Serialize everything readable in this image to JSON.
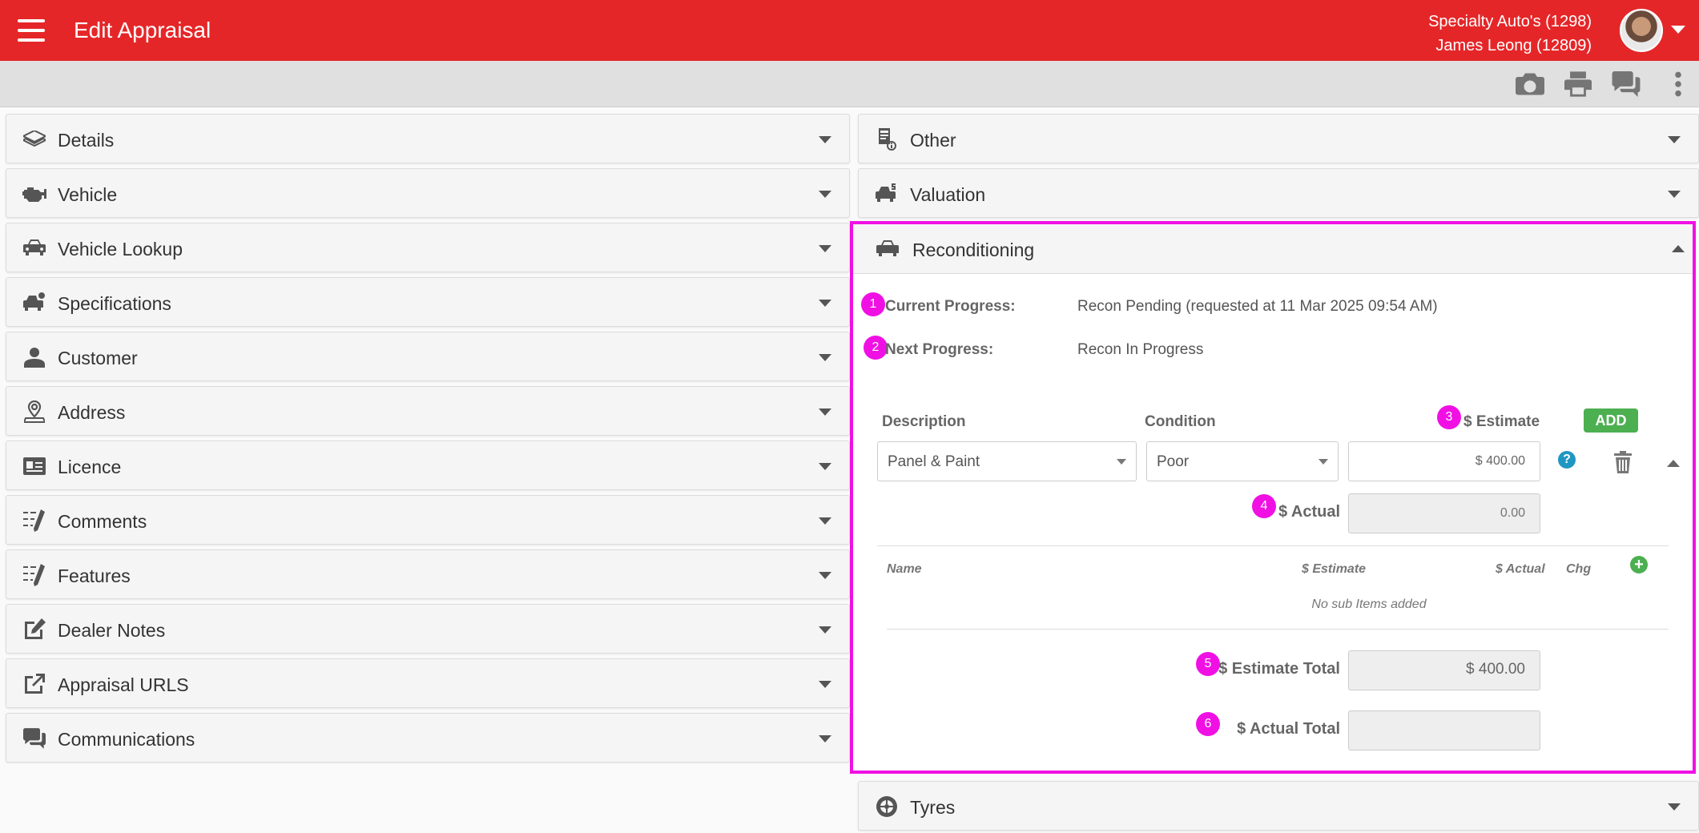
{
  "header": {
    "title": "Edit Appraisal",
    "dealer": "Specialty Auto's (1298)",
    "user": "James Leong (12809)"
  },
  "toolbar": {
    "icons": [
      "camera-icon",
      "print-icon",
      "chat-icon",
      "more-vert-icon"
    ]
  },
  "left_panels": [
    {
      "label": "Details",
      "icon": "layers-icon"
    },
    {
      "label": "Vehicle",
      "icon": "engine-icon"
    },
    {
      "label": "Vehicle Lookup",
      "icon": "car-search-icon"
    },
    {
      "label": "Specifications",
      "icon": "car-settings-icon"
    },
    {
      "label": "Customer",
      "icon": "person-icon"
    },
    {
      "label": "Address",
      "icon": "map-pin-icon"
    },
    {
      "label": "Licence",
      "icon": "id-card-icon"
    },
    {
      "label": "Comments",
      "icon": "checklist-pen-icon"
    },
    {
      "label": "Features",
      "icon": "checklist-pen-icon"
    },
    {
      "label": "Dealer Notes",
      "icon": "edit-note-icon"
    },
    {
      "label": "Appraisal URLS",
      "icon": "external-link-icon"
    },
    {
      "label": "Communications",
      "icon": "chat-icon"
    }
  ],
  "right_panels": {
    "other": {
      "label": "Other",
      "icon": "document-info-icon"
    },
    "valuation": {
      "label": "Valuation",
      "icon": "car-dollar-icon"
    },
    "tyres": {
      "label": "Tyres",
      "icon": "tyre-icon"
    }
  },
  "reconditioning": {
    "label": "Reconditioning",
    "icon": "car-icon",
    "current_progress_label": "Current Progress:",
    "current_progress_value": "Recon Pending (requested at 11 Mar 2025 09:54 AM)",
    "next_progress_label": "Next Progress:",
    "next_progress_value": "Recon In Progress",
    "columns": {
      "description": "Description",
      "condition": "Condition",
      "estimate": "$ Estimate"
    },
    "add_label": "ADD",
    "item": {
      "description": "Panel & Paint",
      "condition": "Poor",
      "estimate": "$ 400.00",
      "actual_label": "$ Actual",
      "actual_placeholder": "0.00"
    },
    "sub_items": {
      "name": "Name",
      "estimate": "$ Estimate",
      "actual": "$ Actual",
      "chg": "Chg",
      "empty_text": "No sub Items added"
    },
    "estimate_total_label": "$ Estimate Total",
    "estimate_total_value": "$ 400.00",
    "actual_total_label": "$ Actual Total",
    "actual_total_value": ""
  },
  "markers": [
    "1",
    "2",
    "3",
    "4",
    "5",
    "6"
  ],
  "colors": {
    "header_red": "#e52628",
    "highlight_magenta": "#f010e4",
    "add_green": "#4caf50",
    "help_blue": "#2196c3"
  }
}
